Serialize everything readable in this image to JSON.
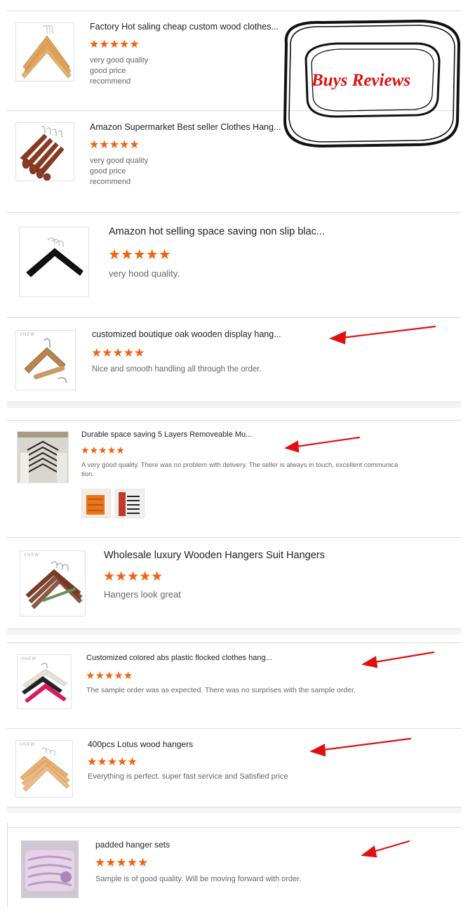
{
  "stars": "★★★★★",
  "stamp_text": "Buys Reviews",
  "accent_color": "#f2610c",
  "arrow_color": "#e01010",
  "thumb_watermark": "VNEW",
  "reviews": [
    {
      "title": "Factory Hot saling cheap custom wood clothes...",
      "lines": [
        "very good quality",
        "good price",
        "recommend"
      ],
      "image": "wood-hangers-stack"
    },
    {
      "title": "Amazon Supermarket Best seller Clothes Hang...",
      "lines": [
        "very good quality",
        "good price",
        "recommend"
      ],
      "image": "brown-hangers-row"
    },
    {
      "title": "Amazon hot selling space saving non slip blac...",
      "lines": [
        "very hood quality."
      ],
      "image": "black-velvet-hangers"
    },
    {
      "title": "customized boutique oak wooden display hang...",
      "lines": [
        "Nice and smooth handling all through the order."
      ],
      "image": "oak-suit-hanger"
    },
    {
      "title": "Durable space saving 5 Layers Removeable Mu...",
      "lines": [
        "A very good quality. There was no problem with delivery. The seller is always in touch, excellent communica",
        "tion."
      ],
      "image": "layered-hanger-photo"
    },
    {
      "title": "Wholesale luxury Wooden Hangers Suit Hangers",
      "lines": [
        "Hangers look great"
      ],
      "image": "wooden-suit-hangers"
    },
    {
      "title": "Customized colored abs plastic flocked clothes hang...",
      "lines": [
        "The sample order was as expected. There was no surprises with the sample order."
      ],
      "image": "colored-flocked-hangers"
    },
    {
      "title": "400pcs Lotus wood hangers",
      "lines": [
        "Everything is perfect. super fast service and Satisfied price"
      ],
      "image": "lotus-wood-hangers"
    },
    {
      "title": "padded hanger sets",
      "lines": [
        "Sample is of good quality. Will be moving forward with order."
      ],
      "image": "padded-hanger-set"
    }
  ]
}
